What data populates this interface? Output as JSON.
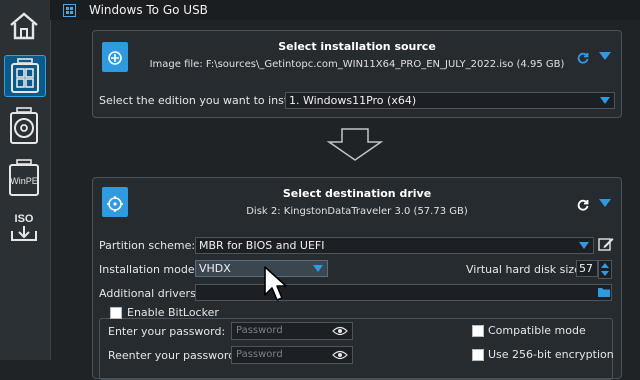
{
  "titlebar": {
    "title": "Windows To Go USB"
  },
  "sidebar": {
    "items": [
      {
        "label": "",
        "icon": "home-icon"
      },
      {
        "label": "",
        "icon": "windows-grid-icon",
        "active": true
      },
      {
        "label": "",
        "icon": "disk-icon"
      },
      {
        "label": "WinPE",
        "icon": "winpe-icon"
      },
      {
        "label": "ISO",
        "icon": "iso-download-icon"
      }
    ]
  },
  "source": {
    "title": "Select installation source",
    "subtitle": "Image file: F:\\sources\\_Getintopc.com_WIN11X64_PRO_EN_JULY_2022.iso (4.95 GB)",
    "edition_label": "Select the edition you want to install:",
    "edition_value": "1. Windows11Pro (x64)"
  },
  "destination": {
    "title": "Select destination drive",
    "subtitle": "Disk 2: KingstonDataTraveler 3.0 (57.73 GB)",
    "partition_label": "Partition scheme:",
    "partition_value": "MBR for BIOS and UEFI",
    "mode_label": "Installation mode:",
    "mode_value": "VHDX",
    "vhd_size_label": "Virtual hard disk size:",
    "vhd_size_value": "57",
    "drivers_label": "Additional drivers:",
    "drivers_value": ""
  },
  "bitlocker": {
    "enable_label": "Enable BitLocker",
    "password_label": "Enter your password:",
    "password_placeholder": "Password",
    "reenter_label": "Reenter your password:",
    "reenter_placeholder": "Password",
    "compatible_label": "Compatible mode",
    "aes256_label": "Use 256-bit encryption"
  },
  "colors": {
    "accent": "#2f9ae0",
    "active_nav": "#0c5a8a",
    "background": "#1f2326"
  }
}
